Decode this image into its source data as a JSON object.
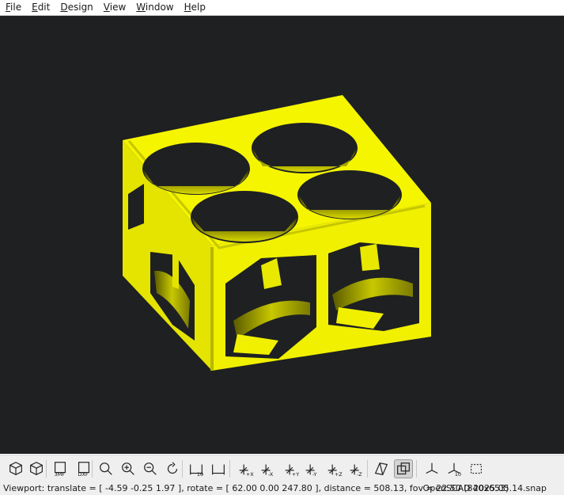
{
  "menu": [
    "File",
    "Edit",
    "Design",
    "View",
    "Window",
    "Help"
  ],
  "menu_accelerators": [
    "F",
    "E",
    "D",
    "V",
    "W",
    "H"
  ],
  "colors": {
    "model": "#f5f500",
    "viewport_bg": "#1e2022",
    "toolbar_bg": "#efefef"
  },
  "toolbar": [
    {
      "name": "preview-icon",
      "label": ""
    },
    {
      "name": "render-icon",
      "label": ""
    },
    {
      "name": "export-3mf-icon",
      "label": "3MF"
    },
    {
      "name": "export-dxf-icon",
      "label": "DXF"
    },
    {
      "name": "view-all-icon",
      "label": ""
    },
    {
      "name": "zoom-in-icon",
      "label": ""
    },
    {
      "name": "zoom-out-icon",
      "label": ""
    },
    {
      "name": "reset-view-icon",
      "label": ""
    },
    {
      "name": "measure-distance-icon",
      "label": "10"
    },
    {
      "name": "measure-angle-icon",
      "label": ""
    },
    {
      "name": "view-right-icon",
      "label": "+X"
    },
    {
      "name": "view-left-icon",
      "label": "-X"
    },
    {
      "name": "view-back-icon",
      "label": "+Y"
    },
    {
      "name": "view-front-icon",
      "label": "-Y"
    },
    {
      "name": "view-top-icon",
      "label": "+Z"
    },
    {
      "name": "view-bottom-icon",
      "label": "-Z"
    },
    {
      "name": "perspective-icon",
      "label": ""
    },
    {
      "name": "orthogonal-icon",
      "label": ""
    },
    {
      "name": "show-axes-icon",
      "label": ""
    },
    {
      "name": "show-scale-markers-icon",
      "label": "10"
    },
    {
      "name": "show-edges-icon",
      "label": ""
    }
  ],
  "status": {
    "viewport": "Viewport: translate = [ -4.59 -0.25 1.97 ], rotate = [ 62.00 0.00 247.80 ], distance = 508.13, fov = 22.50 (840x653)",
    "version": "OpenSCAD 2025.05.14.snap"
  }
}
